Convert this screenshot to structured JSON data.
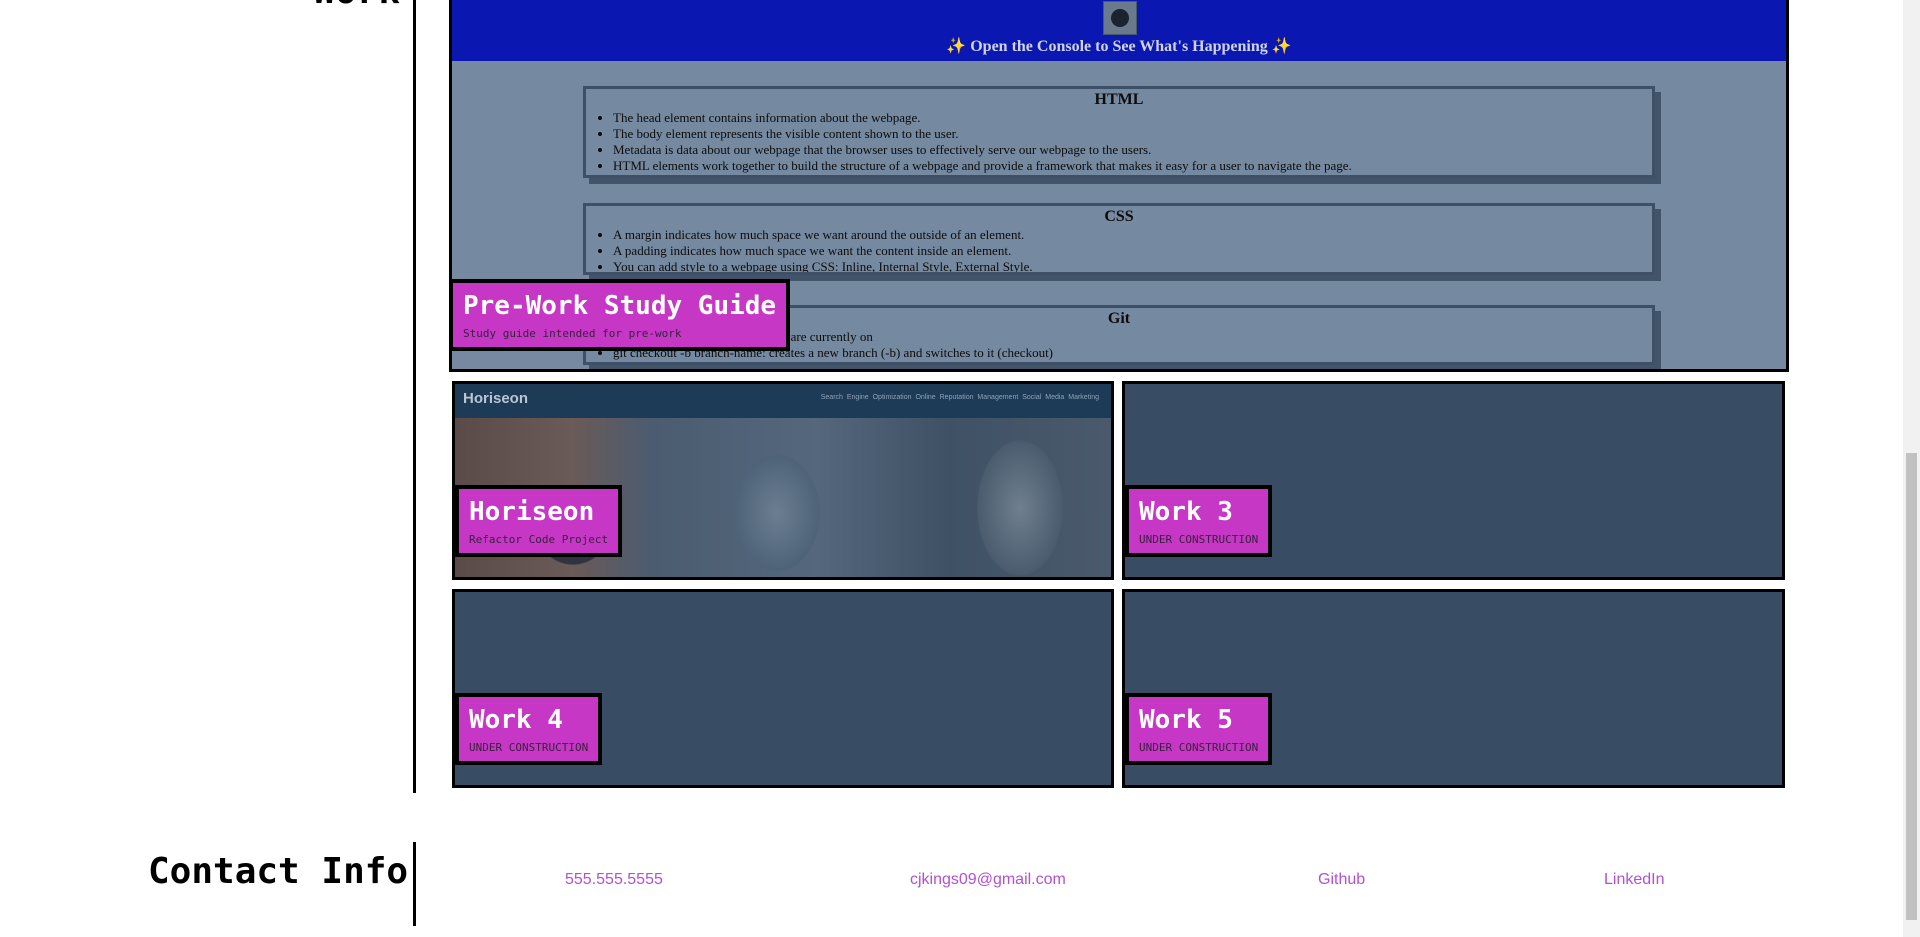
{
  "work": {
    "title": "Work",
    "study_guide": {
      "name": "Pre-Work Study Guide",
      "subtitle": "Study guide intended for pre-work",
      "header_text": "✨ Open the Console to See What's Happening ✨",
      "topics": [
        {
          "heading": "HTML",
          "items": [
            "The head element contains information about the webpage.",
            "The body element represents the visible content shown to the user.",
            "Metadata is data about our webpage that the browser uses to effectively serve our webpage to the users.",
            "HTML elements work together to build the structure of a webpage and provide a framework that makes it easy for a user to navigate the page."
          ]
        },
        {
          "heading": "CSS",
          "items": [
            "A margin indicates how much space we want around the outside of an element.",
            "A padding indicates how much space we want the content inside an element.",
            "You can add style to a webpage using CSS: Inline, Internal Style, External Style."
          ]
        },
        {
          "heading": "Git",
          "items": [
            "git status: checks what branch we are currently on",
            "git checkout -b branch-name: creates a new branch (-b) and switches to it (checkout)"
          ]
        }
      ]
    },
    "horiseon": {
      "name": "Horiseon",
      "subtitle": "Refactor Code Project",
      "preview_logo": "Horiseon",
      "preview_links": "Search Engine Optimization    Online Reputation Management    Social Media Marketing"
    },
    "work3": {
      "name": "Work 3",
      "subtitle": "UNDER CONSTRUCTION"
    },
    "work4": {
      "name": "Work 4",
      "subtitle": "UNDER CONSTRUCTION"
    },
    "work5": {
      "name": "Work 5",
      "subtitle": "UNDER CONSTRUCTION"
    }
  },
  "contact": {
    "title": "Contact Info",
    "phone": "555.555.5555",
    "email": "cjkings09@gmail.com",
    "github": "Github",
    "linkedin": "LinkedIn"
  },
  "colors": {
    "label_bg": "#c637c6",
    "card_bg": "#384d63",
    "link": "#b34fd6",
    "study_header": "#0a17b0"
  }
}
